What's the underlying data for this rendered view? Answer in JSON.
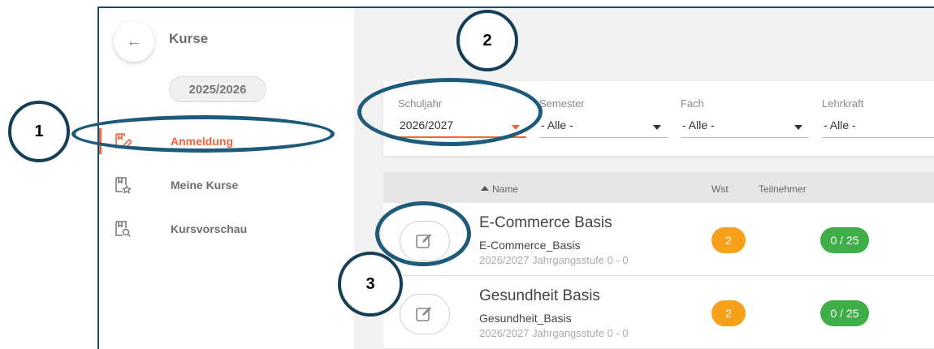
{
  "sidebar": {
    "back_icon": "arrow-left-icon",
    "title": "Kurse",
    "year": "2025/2026",
    "items": [
      {
        "label": "Anmeldung",
        "icon": "book-edit-icon",
        "active": true
      },
      {
        "label": "Meine Kurse",
        "icon": "book-star-icon",
        "active": false
      },
      {
        "label": "Kursvorschau",
        "icon": "book-search-icon",
        "active": false
      }
    ]
  },
  "filters": [
    {
      "label": "Schuljahr",
      "value": "2026/2027"
    },
    {
      "label": "Semester",
      "value": "- Alle -"
    },
    {
      "label": "Fach",
      "value": "- Alle -"
    },
    {
      "label": "Lehrkraft",
      "value": "- Alle -"
    }
  ],
  "table": {
    "columns": {
      "name": "Name",
      "wst": "Wst",
      "teilnehmer": "Teilnehmer"
    },
    "rows": [
      {
        "name": "E-Commerce Basis",
        "code": "E-Commerce_Basis",
        "meta": "2026/2027 Jahrgangsstufe 0 - 0",
        "wst": "2",
        "participants": "0 / 25"
      },
      {
        "name": "Gesundheit Basis",
        "code": "Gesundheit_Basis",
        "meta": "2026/2027 Jahrgangsstufe 0 - 0",
        "wst": "2",
        "participants": "0 / 25"
      }
    ]
  },
  "annotations": {
    "one": "1",
    "two": "2",
    "three": "3"
  },
  "colors": {
    "accent": "#f0643c",
    "wst_badge": "#f7a01b",
    "participants_badge": "#3fae49",
    "annotation": "#1e5a7a"
  }
}
